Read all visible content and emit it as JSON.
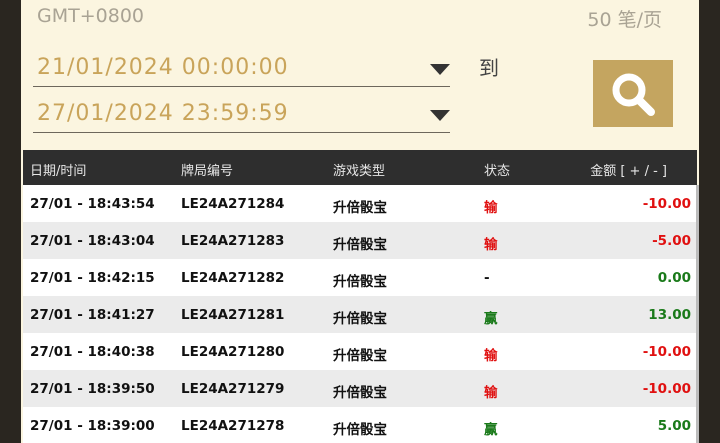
{
  "timezone": "GMT+0800",
  "per_page": "50 笔/页",
  "date_range": {
    "start": "21/01/2024 00:00:00",
    "end": "27/01/2024 23:59:59",
    "to_label": "到"
  },
  "colors": {
    "accent": "#c4a560",
    "date_text": "#c9a45a",
    "negative": "#e01010",
    "positive": "#1a7a1a"
  },
  "table": {
    "headers": [
      "日期/时间",
      "牌局编号",
      "游戏类型",
      "状态",
      "金额 [ + / - ]"
    ],
    "rows": [
      {
        "datetime": "27/01 - 18:43:54",
        "id": "LE24A271284",
        "game": "升倍骰宝",
        "status": "输",
        "amount": "-10.00",
        "result": "lose"
      },
      {
        "datetime": "27/01 - 18:43:04",
        "id": "LE24A271283",
        "game": "升倍骰宝",
        "status": "输",
        "amount": "-5.00",
        "result": "lose"
      },
      {
        "datetime": "27/01 - 18:42:15",
        "id": "LE24A271282",
        "game": "升倍骰宝",
        "status": "-",
        "amount": "0.00",
        "result": "tie"
      },
      {
        "datetime": "27/01 - 18:41:27",
        "id": "LE24A271281",
        "game": "升倍骰宝",
        "status": "赢",
        "amount": "13.00",
        "result": "win"
      },
      {
        "datetime": "27/01 - 18:40:38",
        "id": "LE24A271280",
        "game": "升倍骰宝",
        "status": "输",
        "amount": "-10.00",
        "result": "lose"
      },
      {
        "datetime": "27/01 - 18:39:50",
        "id": "LE24A271279",
        "game": "升倍骰宝",
        "status": "输",
        "amount": "-10.00",
        "result": "lose"
      },
      {
        "datetime": "27/01 - 18:39:00",
        "id": "LE24A271278",
        "game": "升倍骰宝",
        "status": "赢",
        "amount": "5.00",
        "result": "win"
      }
    ]
  }
}
